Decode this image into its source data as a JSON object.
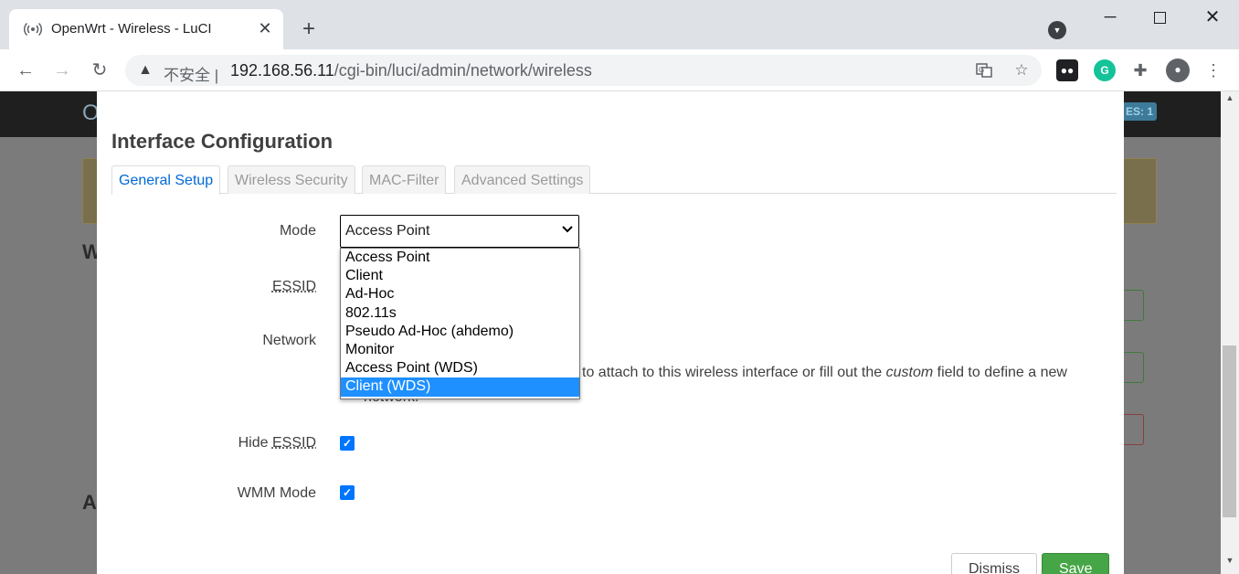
{
  "browser": {
    "tab_title": "OpenWrt - Wireless - LuCI",
    "tab_close": "✕",
    "new_tab": "+",
    "security_label": "不安全",
    "url_host": "192.168.56.11",
    "url_path": "/cgi-bin/luci/admin/network/wireless"
  },
  "background_page": {
    "brand": "O",
    "badge": "ES: 1",
    "heading_1": "W",
    "heading_2": "A"
  },
  "modal": {
    "title": "Interface Configuration",
    "tabs": [
      {
        "label": "General Setup",
        "active": true
      },
      {
        "label": "Wireless Security",
        "active": false
      },
      {
        "label": "MAC-Filter",
        "active": false
      },
      {
        "label": "Advanced Settings",
        "active": false
      }
    ],
    "fields": {
      "mode_label": "Mode",
      "essid_label": "ESSID",
      "network_label": "Network",
      "hide_essid_label_prefix": "Hide ",
      "hide_essid_label_abbr": "ESSID",
      "wmm_label": "WMM Mode"
    },
    "mode_select": {
      "value": "Access Point",
      "options": [
        "Access Point",
        "Client",
        "Ad-Hoc",
        "802.11s",
        "Pseudo Ad-Hoc (ahdemo)",
        "Monitor",
        "Access Point (WDS)",
        "Client (WDS)"
      ],
      "highlighted": "Client (WDS)"
    },
    "network_help": {
      "part1": "to attach to this wireless interface or fill out the ",
      "em": "custom",
      "part2": " field to define a new",
      "line2": "network."
    },
    "hide_essid_checked": true,
    "wmm_checked": true,
    "buttons": {
      "dismiss": "Dismiss",
      "save": "Save"
    }
  },
  "colors": {
    "accent": "#0069d6",
    "save": "#46a546",
    "option_highlight": "#1e90ff"
  }
}
